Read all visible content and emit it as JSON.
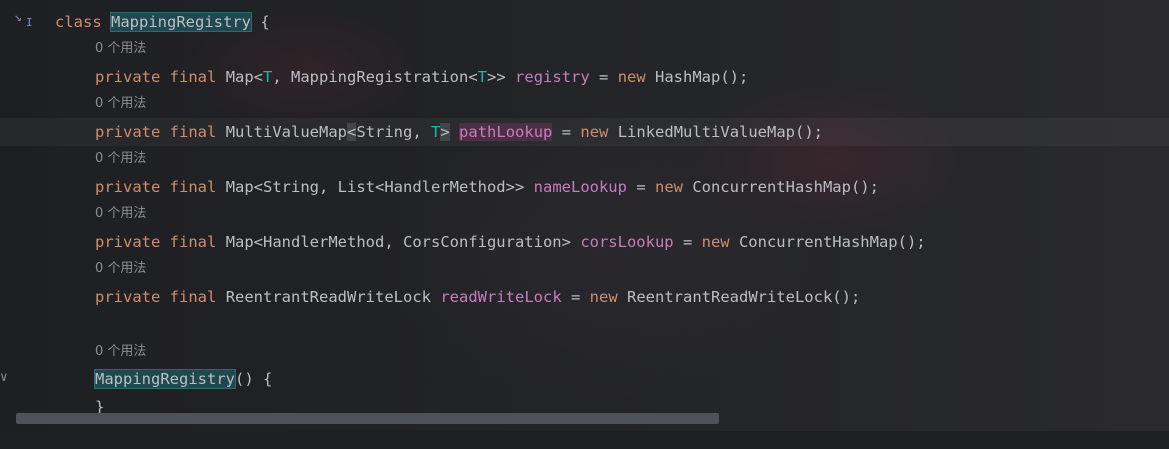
{
  "gutter": {
    "class_fold_icon": "↘",
    "cursor_icon": "I",
    "method_fold_icon": "∨"
  },
  "hint_text": "0 个用法",
  "class_decl": {
    "kw": "class",
    "name": "MappingRegistry",
    "tail": " {"
  },
  "fields": [
    {
      "a": "private",
      "b": "final",
      "type": "Map<",
      "tvar": "T",
      "type2": ", MappingRegistration<",
      "tvar2": "T",
      "type3": ">>",
      "name": "registry",
      "eq": " = ",
      "new": "new",
      "init": " HashMap();"
    },
    {
      "a": "private",
      "b": "final",
      "type": "MultiValueMap",
      "lt": "<",
      "type2": "String, ",
      "tvar": "T",
      "gt": ">",
      "name": "pathLookup",
      "eq": " = ",
      "new": "new",
      "init": " LinkedMultiValueMap();"
    },
    {
      "a": "private",
      "b": "final",
      "type": "Map<String, List<HandlerMethod>>",
      "name": "nameLookup",
      "eq": " = ",
      "new": "new",
      "init": " ConcurrentHashMap();"
    },
    {
      "a": "private",
      "b": "final",
      "type": "Map<HandlerMethod, CorsConfiguration>",
      "name": "corsLookup",
      "eq": " = ",
      "new": "new",
      "init": " ConcurrentHashMap();"
    },
    {
      "a": "private",
      "b": "final",
      "type": "ReentrantReadWriteLock",
      "name": "readWriteLock",
      "eq": " = ",
      "new": "new",
      "init": " ReentrantReadWriteLock();"
    }
  ],
  "constructor": {
    "name": "MappingRegistry",
    "tail": "() {"
  },
  "closing": "}"
}
